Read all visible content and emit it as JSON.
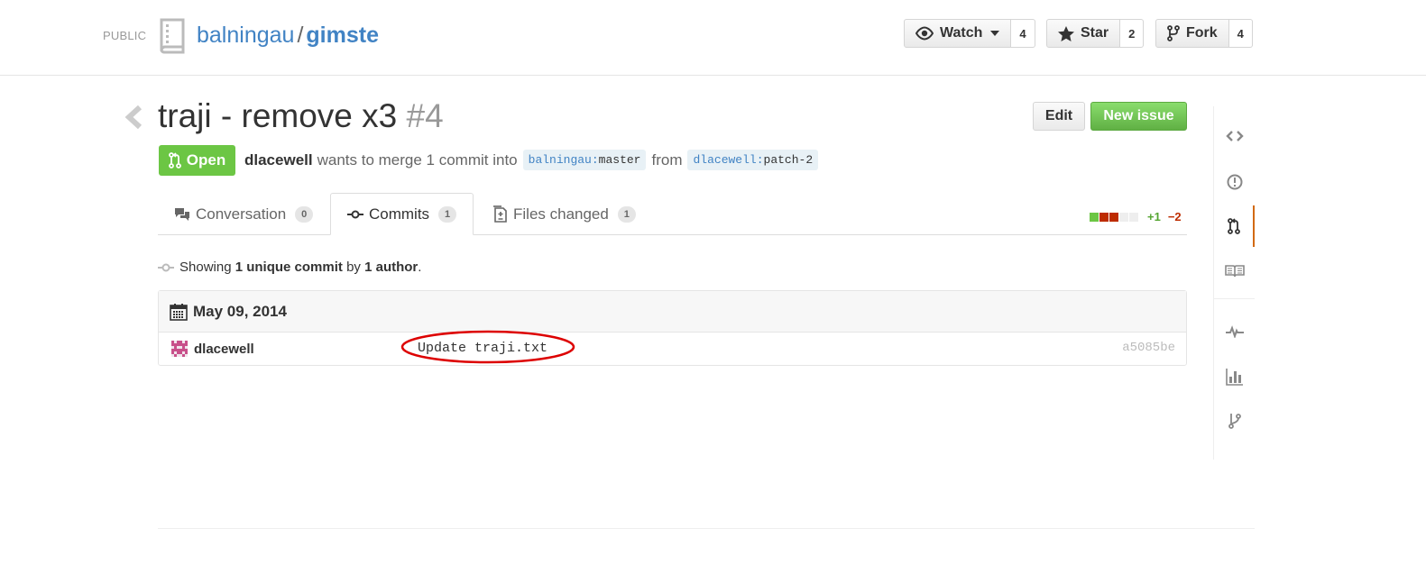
{
  "repo": {
    "visibility": "PUBLIC",
    "owner": "balningau",
    "separator": "/",
    "name": "gimste"
  },
  "actions": {
    "watch": {
      "label": "Watch",
      "count": "4"
    },
    "star": {
      "label": "Star",
      "count": "2"
    },
    "fork": {
      "label": "Fork",
      "count": "4"
    }
  },
  "pull_request": {
    "title": "traji - remove x3",
    "number": "#4",
    "state": "Open",
    "author": "dlacewell",
    "merge_text": "wants to merge 1 commit into",
    "base_owner": "balningau",
    "base_branch": "master",
    "from_text": "from",
    "head_owner": "dlacewell",
    "head_branch": "patch-2",
    "edit_label": "Edit",
    "new_issue_label": "New issue"
  },
  "tabs": [
    {
      "label": "Conversation",
      "count": "0",
      "icon": "comment-discussion-icon"
    },
    {
      "label": "Commits",
      "count": "1",
      "icon": "git-commit-icon",
      "selected": true
    },
    {
      "label": "Files changed",
      "count": "1",
      "icon": "diff-icon"
    }
  ],
  "diffstat": {
    "additions": "+1",
    "deletions": "−2",
    "blocks": [
      "added",
      "deleted",
      "deleted",
      "neutral",
      "neutral"
    ],
    "colors": {
      "added": "#6cc644",
      "deleted": "#bd2c00",
      "neutral": "#eeeeee"
    }
  },
  "summary": {
    "prefix": "Showing",
    "commits": "1 unique commit",
    "by": "by",
    "authors": "1 author",
    "suffix": "."
  },
  "commit_group": {
    "date": "May 09, 2014",
    "commits": [
      {
        "author": "dlacewell",
        "message": "Update traji.txt",
        "sha": "a5085be"
      }
    ]
  },
  "sidebar": {
    "items": [
      {
        "icon": "code-icon"
      },
      {
        "icon": "issue-opened-icon"
      },
      {
        "icon": "git-pull-request-icon",
        "selected": true
      },
      {
        "icon": "book-icon"
      },
      {
        "icon": "pulse-icon"
      },
      {
        "icon": "graph-icon"
      },
      {
        "icon": "git-branch-icon"
      }
    ]
  },
  "colors": {
    "link": "#4183c4",
    "open_green": "#6cc644",
    "primary_green": "#60b044",
    "annotation_red": "#dd0000",
    "selected_accent": "#d26911"
  }
}
